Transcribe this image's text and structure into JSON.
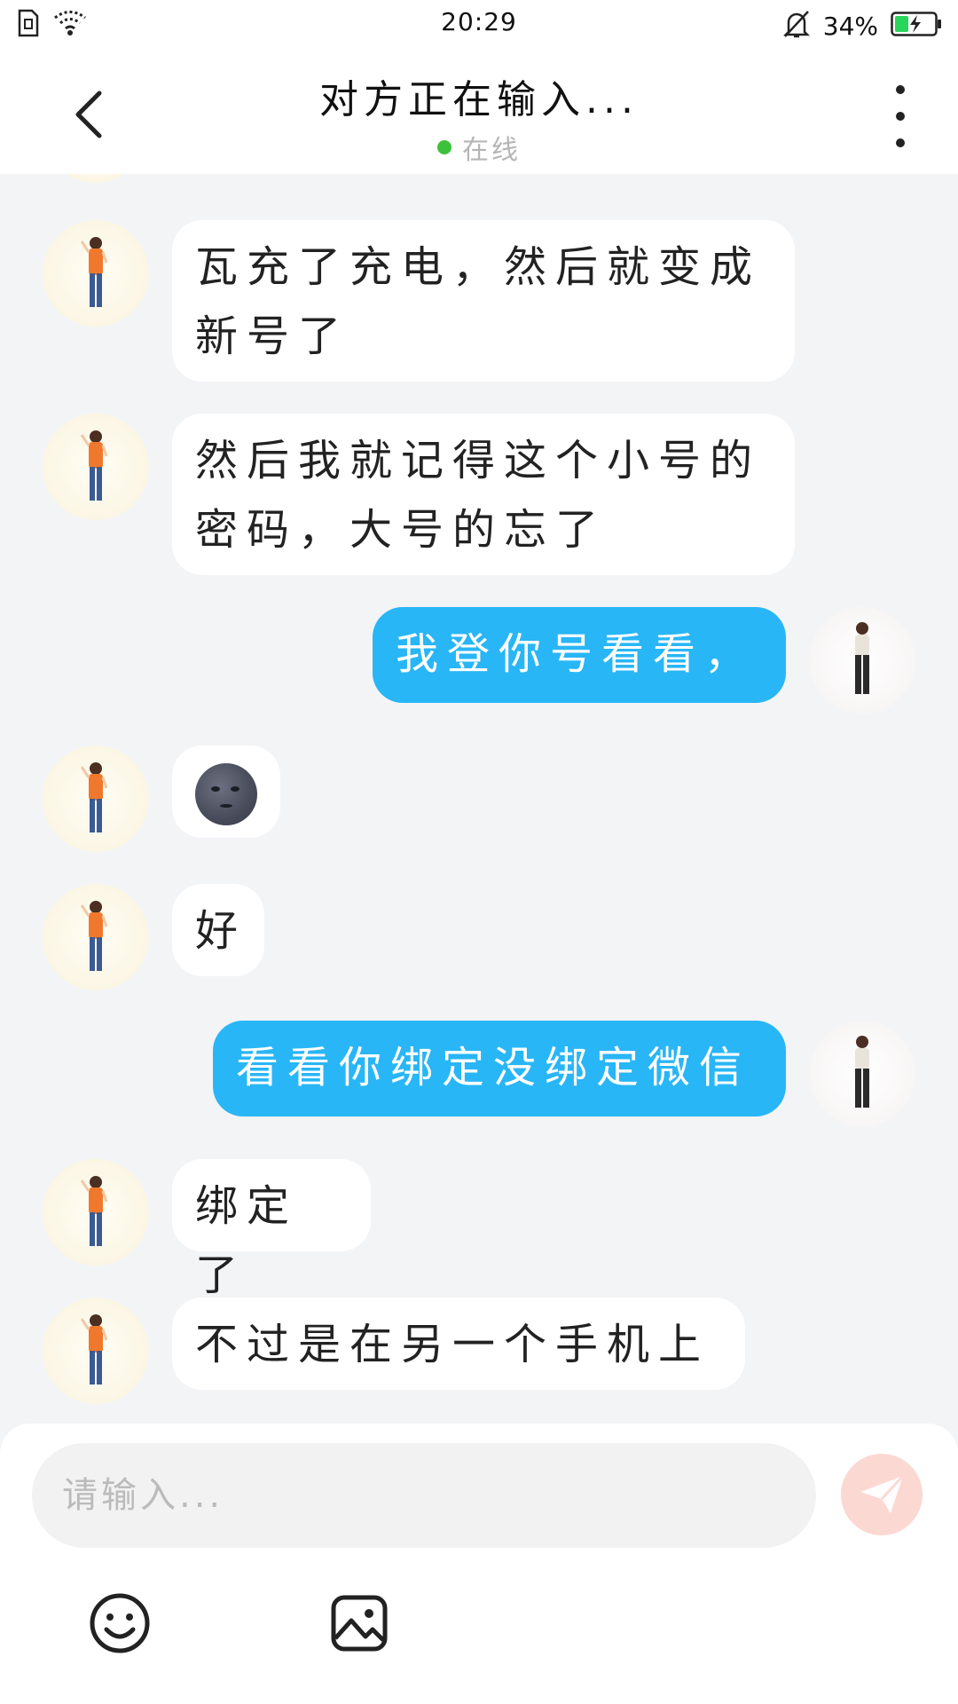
{
  "status_bar": {
    "time": "20:29",
    "battery_percent": "34%",
    "battery_level": 0.34,
    "icons": [
      "sim-icon",
      "wifi-icon",
      "bell-muted-icon",
      "battery-charging-icon"
    ]
  },
  "header": {
    "title": "对方正在输入...",
    "status": "在线",
    "status_color": "#3ec13a"
  },
  "messages": [
    {
      "side": "in",
      "lines": [
        "瓦充了充电，然后就变成",
        "新号了"
      ]
    },
    {
      "side": "in",
      "lines": [
        "然后我就记得这个小号的",
        "密码，大号的忘了"
      ]
    },
    {
      "side": "out",
      "lines": [
        "我登你号看看，"
      ]
    },
    {
      "side": "in",
      "emoji": "new-moon-face-emoji"
    },
    {
      "side": "in",
      "lines": [
        "好"
      ]
    },
    {
      "side": "out",
      "lines": [
        "看看你绑定没绑定微信"
      ]
    },
    {
      "side": "in",
      "lines": [
        "绑定了"
      ]
    },
    {
      "side": "in",
      "lines": [
        "不过是在另一个手机上"
      ]
    }
  ],
  "composer": {
    "placeholder": "请输入...",
    "send_color": "#f48a7a",
    "tools": [
      "smiley-icon",
      "image-icon"
    ]
  },
  "colors": {
    "outgoing_bubble": "#28b6f6",
    "incoming_bubble": "#ffffff",
    "chat_background": "#f3f4f6"
  }
}
